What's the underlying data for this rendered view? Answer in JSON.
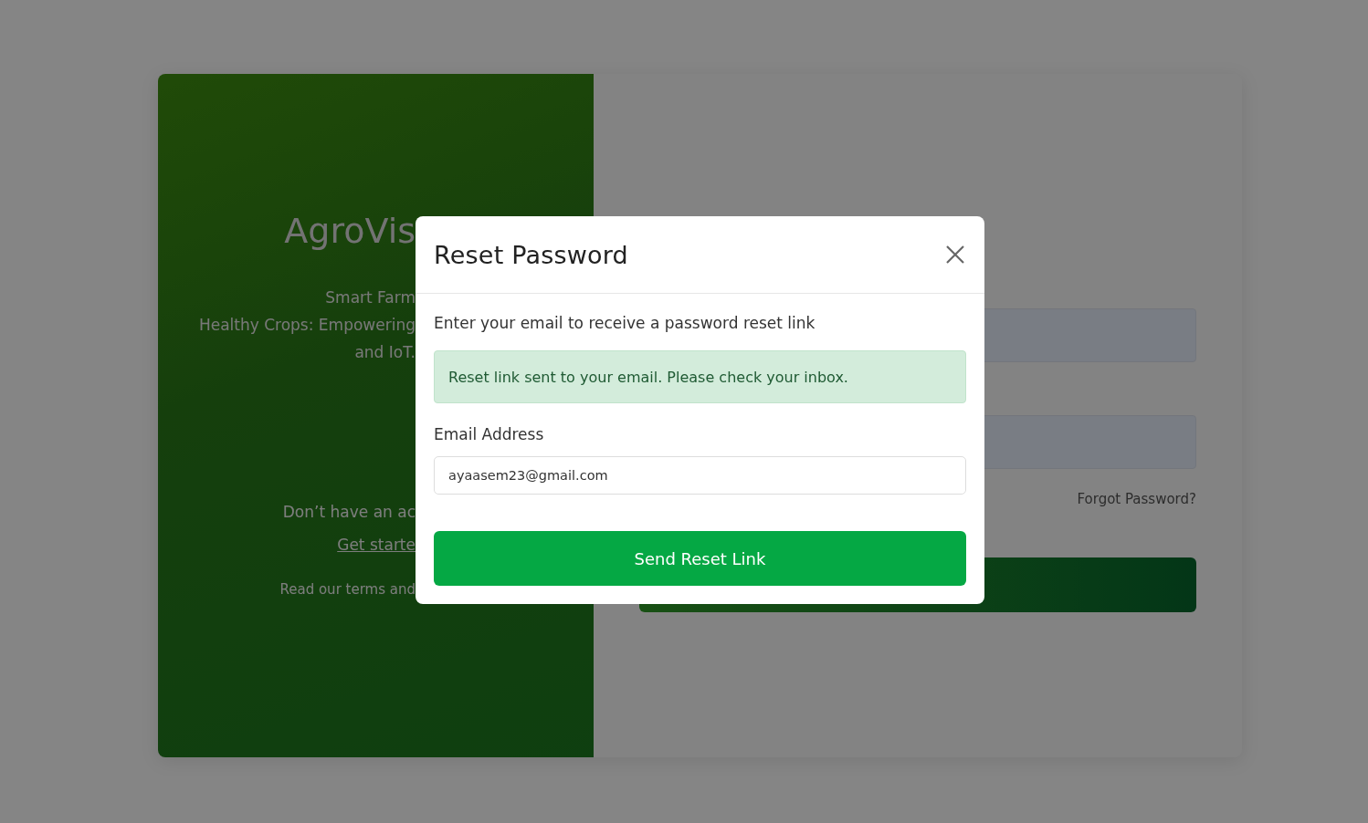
{
  "brand_panel": {
    "title": "AgroVis",
    "tagline_lines": [
      "Smart Farm",
      "Healthy Crops: Empowering",
      "and IoT."
    ],
    "signup_prompt": "Don’t have an ac",
    "signup_link": "Get starte",
    "terms_text": "Read our terms and"
  },
  "login_form": {
    "fields": [
      {
        "kind": "input"
      },
      {
        "kind": "input"
      }
    ],
    "forgot_link": "Forgot Password?"
  },
  "modal": {
    "title": "Reset Password",
    "instruction": "Enter your email to receive a password reset link",
    "alert": {
      "kind": "success",
      "text": "Reset link sent to your email. Please check your inbox."
    },
    "email_label": "Email Address",
    "email_value": "ayaasem23@gmail.com",
    "submit_label": "Send Reset Link"
  }
}
